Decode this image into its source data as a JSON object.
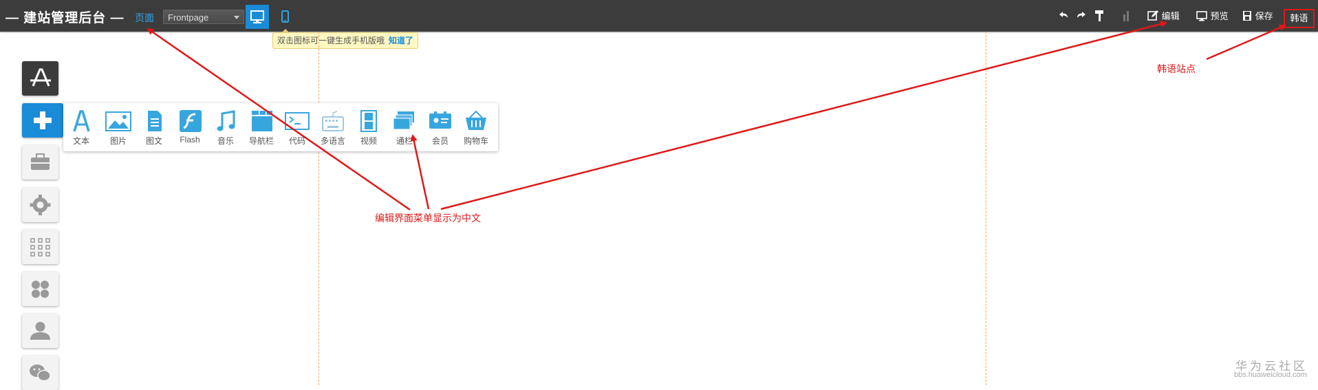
{
  "header": {
    "brand": "— 建站管理后台 —",
    "page_label": "页面",
    "page_select_value": "Frontpage",
    "tools": {
      "edit": "编辑",
      "preview": "预览",
      "save": "保存",
      "language": "韩语"
    }
  },
  "tip": {
    "text": "双击图标可一键生成手机版哦",
    "ok": "知道了"
  },
  "widgets": [
    {
      "label": "文本",
      "icon": "text-icon"
    },
    {
      "label": "图片",
      "icon": "image-icon"
    },
    {
      "label": "图文",
      "icon": "image-text-icon"
    },
    {
      "label": "Flash",
      "icon": "flash-icon"
    },
    {
      "label": "音乐",
      "icon": "music-icon"
    },
    {
      "label": "导航栏",
      "icon": "navbar-icon"
    },
    {
      "label": "代码",
      "icon": "code-icon"
    },
    {
      "label": "多语言",
      "icon": "keyboard-icon"
    },
    {
      "label": "视频",
      "icon": "video-icon"
    },
    {
      "label": "通栏",
      "icon": "banner-icon"
    },
    {
      "label": "会员",
      "icon": "member-icon"
    },
    {
      "label": "购物车",
      "icon": "cart-icon"
    }
  ],
  "annotations": {
    "menu_note": "编辑界面菜单显示为中文",
    "site_note": "韩语站点"
  },
  "watermark": {
    "title": "华为云社区",
    "url": "bbs.huaweicloud.com"
  },
  "colors": {
    "topbar": "#3c3c3c",
    "accent": "#1a8bd7",
    "annotation": "#e01818",
    "guide": "#f0a968"
  }
}
